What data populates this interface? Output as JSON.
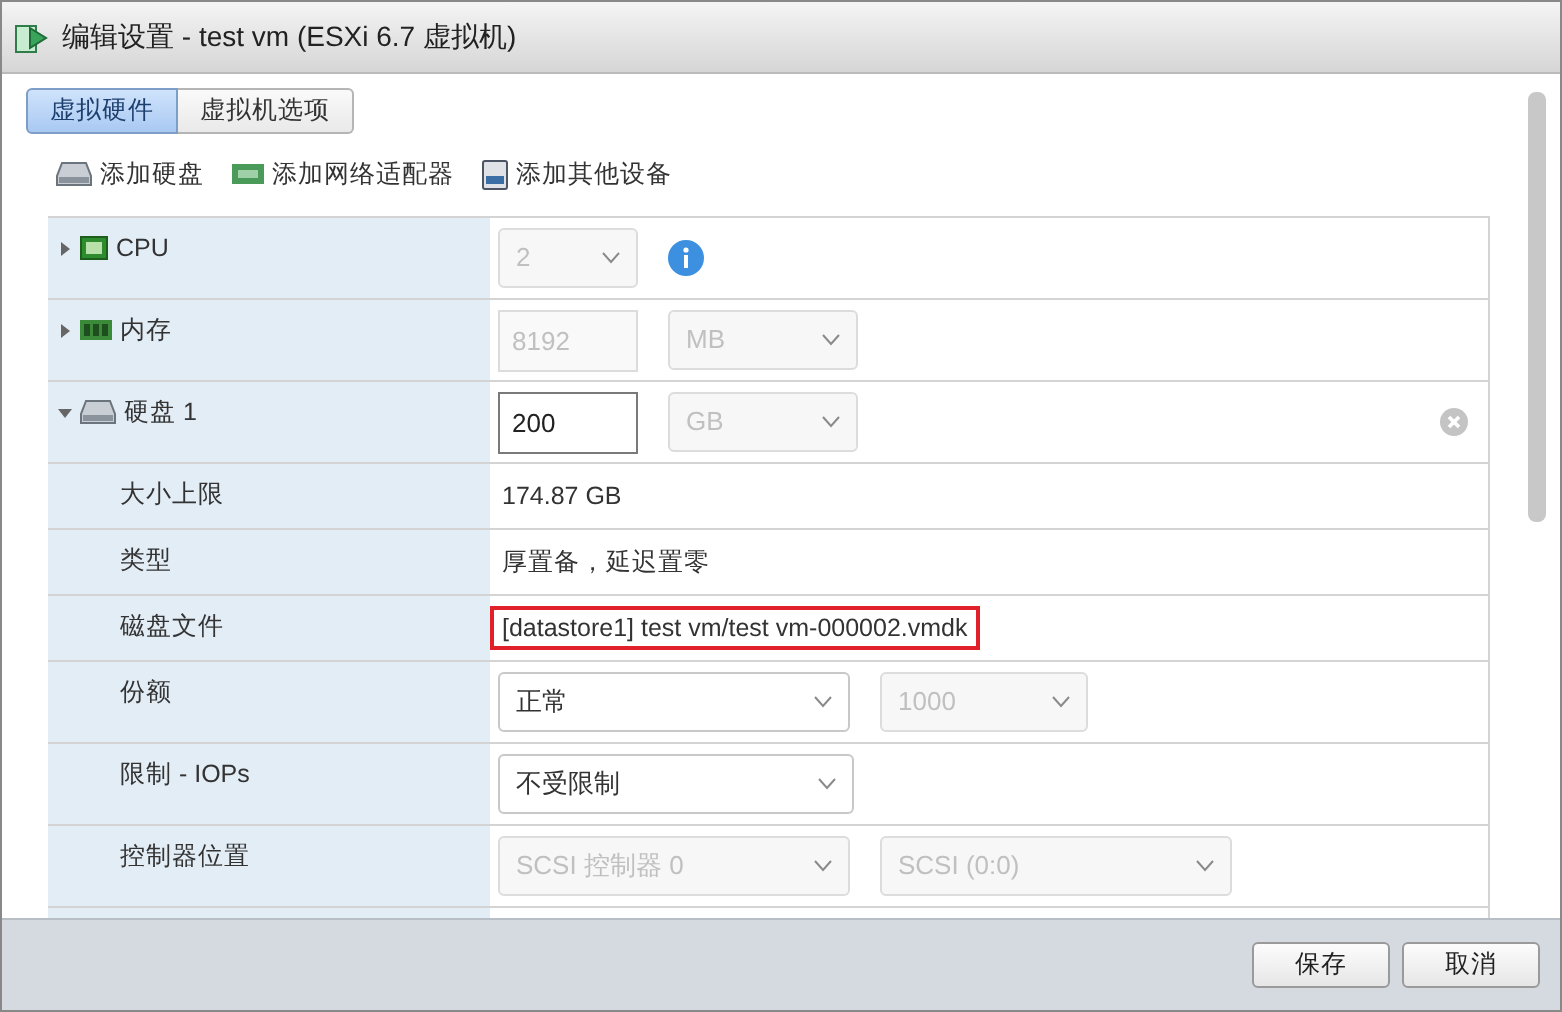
{
  "window": {
    "title": "编辑设置 - test vm (ESXi 6.7 虚拟机)"
  },
  "tabs": [
    {
      "label": "虚拟硬件",
      "selected": true
    },
    {
      "label": "虚拟机选项",
      "selected": false
    }
  ],
  "toolbar": [
    {
      "label": "添加硬盘"
    },
    {
      "label": "添加网络适配器"
    },
    {
      "label": "添加其他设备"
    }
  ],
  "rows": [
    {
      "kind": "device",
      "label": "CPU",
      "expanded": false,
      "controls": [
        {
          "kind": "select",
          "value": "2",
          "disabled": true
        },
        {
          "kind": "info"
        }
      ]
    },
    {
      "kind": "device",
      "label": "内存",
      "expanded": false,
      "controls": [
        {
          "kind": "input",
          "value": "8192",
          "disabled": true
        },
        {
          "kind": "select",
          "value": "MB",
          "disabled": true
        }
      ]
    },
    {
      "kind": "device",
      "label": "硬盘 1",
      "expanded": true,
      "removable": true,
      "controls": [
        {
          "kind": "input",
          "value": "200",
          "disabled": false
        },
        {
          "kind": "select",
          "value": "GB",
          "disabled": true
        }
      ]
    },
    {
      "kind": "property",
      "label": "大小上限",
      "controls": [
        {
          "kind": "text",
          "value": "174.87 GB",
          "highlighted": false
        }
      ]
    },
    {
      "kind": "property",
      "label": "类型",
      "controls": [
        {
          "kind": "text",
          "value": "厚置备，延迟置零",
          "highlighted": false
        }
      ]
    },
    {
      "kind": "property",
      "label": "磁盘文件",
      "controls": [
        {
          "kind": "text",
          "value": "[datastore1] test vm/test vm-000002.vmdk",
          "highlighted": true
        }
      ]
    },
    {
      "kind": "property",
      "label": "份额",
      "controls": [
        {
          "kind": "select",
          "value": "正常",
          "disabled": false
        },
        {
          "kind": "select",
          "value": "1000",
          "disabled": true
        }
      ]
    },
    {
      "kind": "property",
      "label": "限制 - IOPs",
      "controls": [
        {
          "kind": "select",
          "value": "不受限制",
          "disabled": false
        }
      ]
    },
    {
      "kind": "property",
      "label": "控制器位置",
      "controls": [
        {
          "kind": "select",
          "value": "SCSI 控制器 0",
          "disabled": true
        },
        {
          "kind": "select",
          "value": "SCSI (0:0)",
          "disabled": true
        }
      ]
    }
  ],
  "buttons": [
    {
      "label": "保存"
    },
    {
      "label": "取消"
    }
  ]
}
